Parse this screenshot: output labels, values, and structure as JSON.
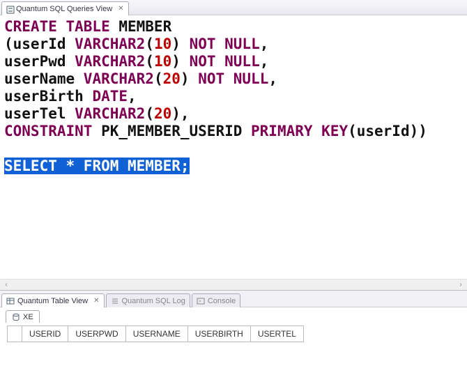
{
  "topTab": {
    "title": "Quantum SQL Queries View"
  },
  "code": {
    "lines": [
      {
        "s": [
          {
            "t": "CREATE TABLE",
            "c": "kw"
          },
          {
            "t": " MEMBER",
            "c": "txt"
          }
        ]
      },
      {
        "s": [
          {
            "t": "(userId ",
            "c": "txt"
          },
          {
            "t": "VARCHAR2",
            "c": "kw"
          },
          {
            "t": "(",
            "c": "txt"
          },
          {
            "t": "10",
            "c": "num"
          },
          {
            "t": ") ",
            "c": "txt"
          },
          {
            "t": "NOT NULL",
            "c": "kw"
          },
          {
            "t": ",",
            "c": "txt"
          }
        ]
      },
      {
        "s": [
          {
            "t": "userPwd ",
            "c": "txt"
          },
          {
            "t": "VARCHAR2",
            "c": "kw"
          },
          {
            "t": "(",
            "c": "txt"
          },
          {
            "t": "10",
            "c": "num"
          },
          {
            "t": ") ",
            "c": "txt"
          },
          {
            "t": "NOT NULL",
            "c": "kw"
          },
          {
            "t": ",",
            "c": "txt"
          }
        ]
      },
      {
        "s": [
          {
            "t": "userName ",
            "c": "txt"
          },
          {
            "t": "VARCHAR2",
            "c": "kw"
          },
          {
            "t": "(",
            "c": "txt"
          },
          {
            "t": "20",
            "c": "num"
          },
          {
            "t": ") ",
            "c": "txt"
          },
          {
            "t": "NOT NULL",
            "c": "kw"
          },
          {
            "t": ",",
            "c": "txt"
          }
        ]
      },
      {
        "s": [
          {
            "t": "userBirth ",
            "c": "txt"
          },
          {
            "t": "DATE",
            "c": "kw"
          },
          {
            "t": ",",
            "c": "txt"
          }
        ]
      },
      {
        "s": [
          {
            "t": "userTel ",
            "c": "txt"
          },
          {
            "t": "VARCHAR2",
            "c": "kw"
          },
          {
            "t": "(",
            "c": "txt"
          },
          {
            "t": "20",
            "c": "num"
          },
          {
            "t": "),",
            "c": "txt"
          }
        ]
      },
      {
        "s": [
          {
            "t": "CONSTRAINT",
            "c": "kw"
          },
          {
            "t": " PK_MEMBER_USERID ",
            "c": "txt"
          },
          {
            "t": "PRIMARY KEY",
            "c": "kw"
          },
          {
            "t": "(userId))",
            "c": "txt"
          }
        ]
      },
      {
        "s": []
      },
      {
        "sel": true,
        "s": [
          {
            "t": "SELECT",
            "c": "kw"
          },
          {
            "t": " * ",
            "c": "txt"
          },
          {
            "t": "FROM",
            "c": "kw"
          },
          {
            "t": " MEMBER;",
            "c": "txt"
          }
        ]
      }
    ]
  },
  "bottomTabs": [
    {
      "label": "Quantum Table View",
      "active": true,
      "icon": "table-icon"
    },
    {
      "label": "Quantum SQL Log",
      "active": false,
      "icon": "list-icon"
    },
    {
      "label": "Console",
      "active": false,
      "icon": "console-icon"
    }
  ],
  "connTab": {
    "label": "XE"
  },
  "columns": [
    "USERID",
    "USERPWD",
    "USERNAME",
    "USERBIRTH",
    "USERTEL"
  ]
}
